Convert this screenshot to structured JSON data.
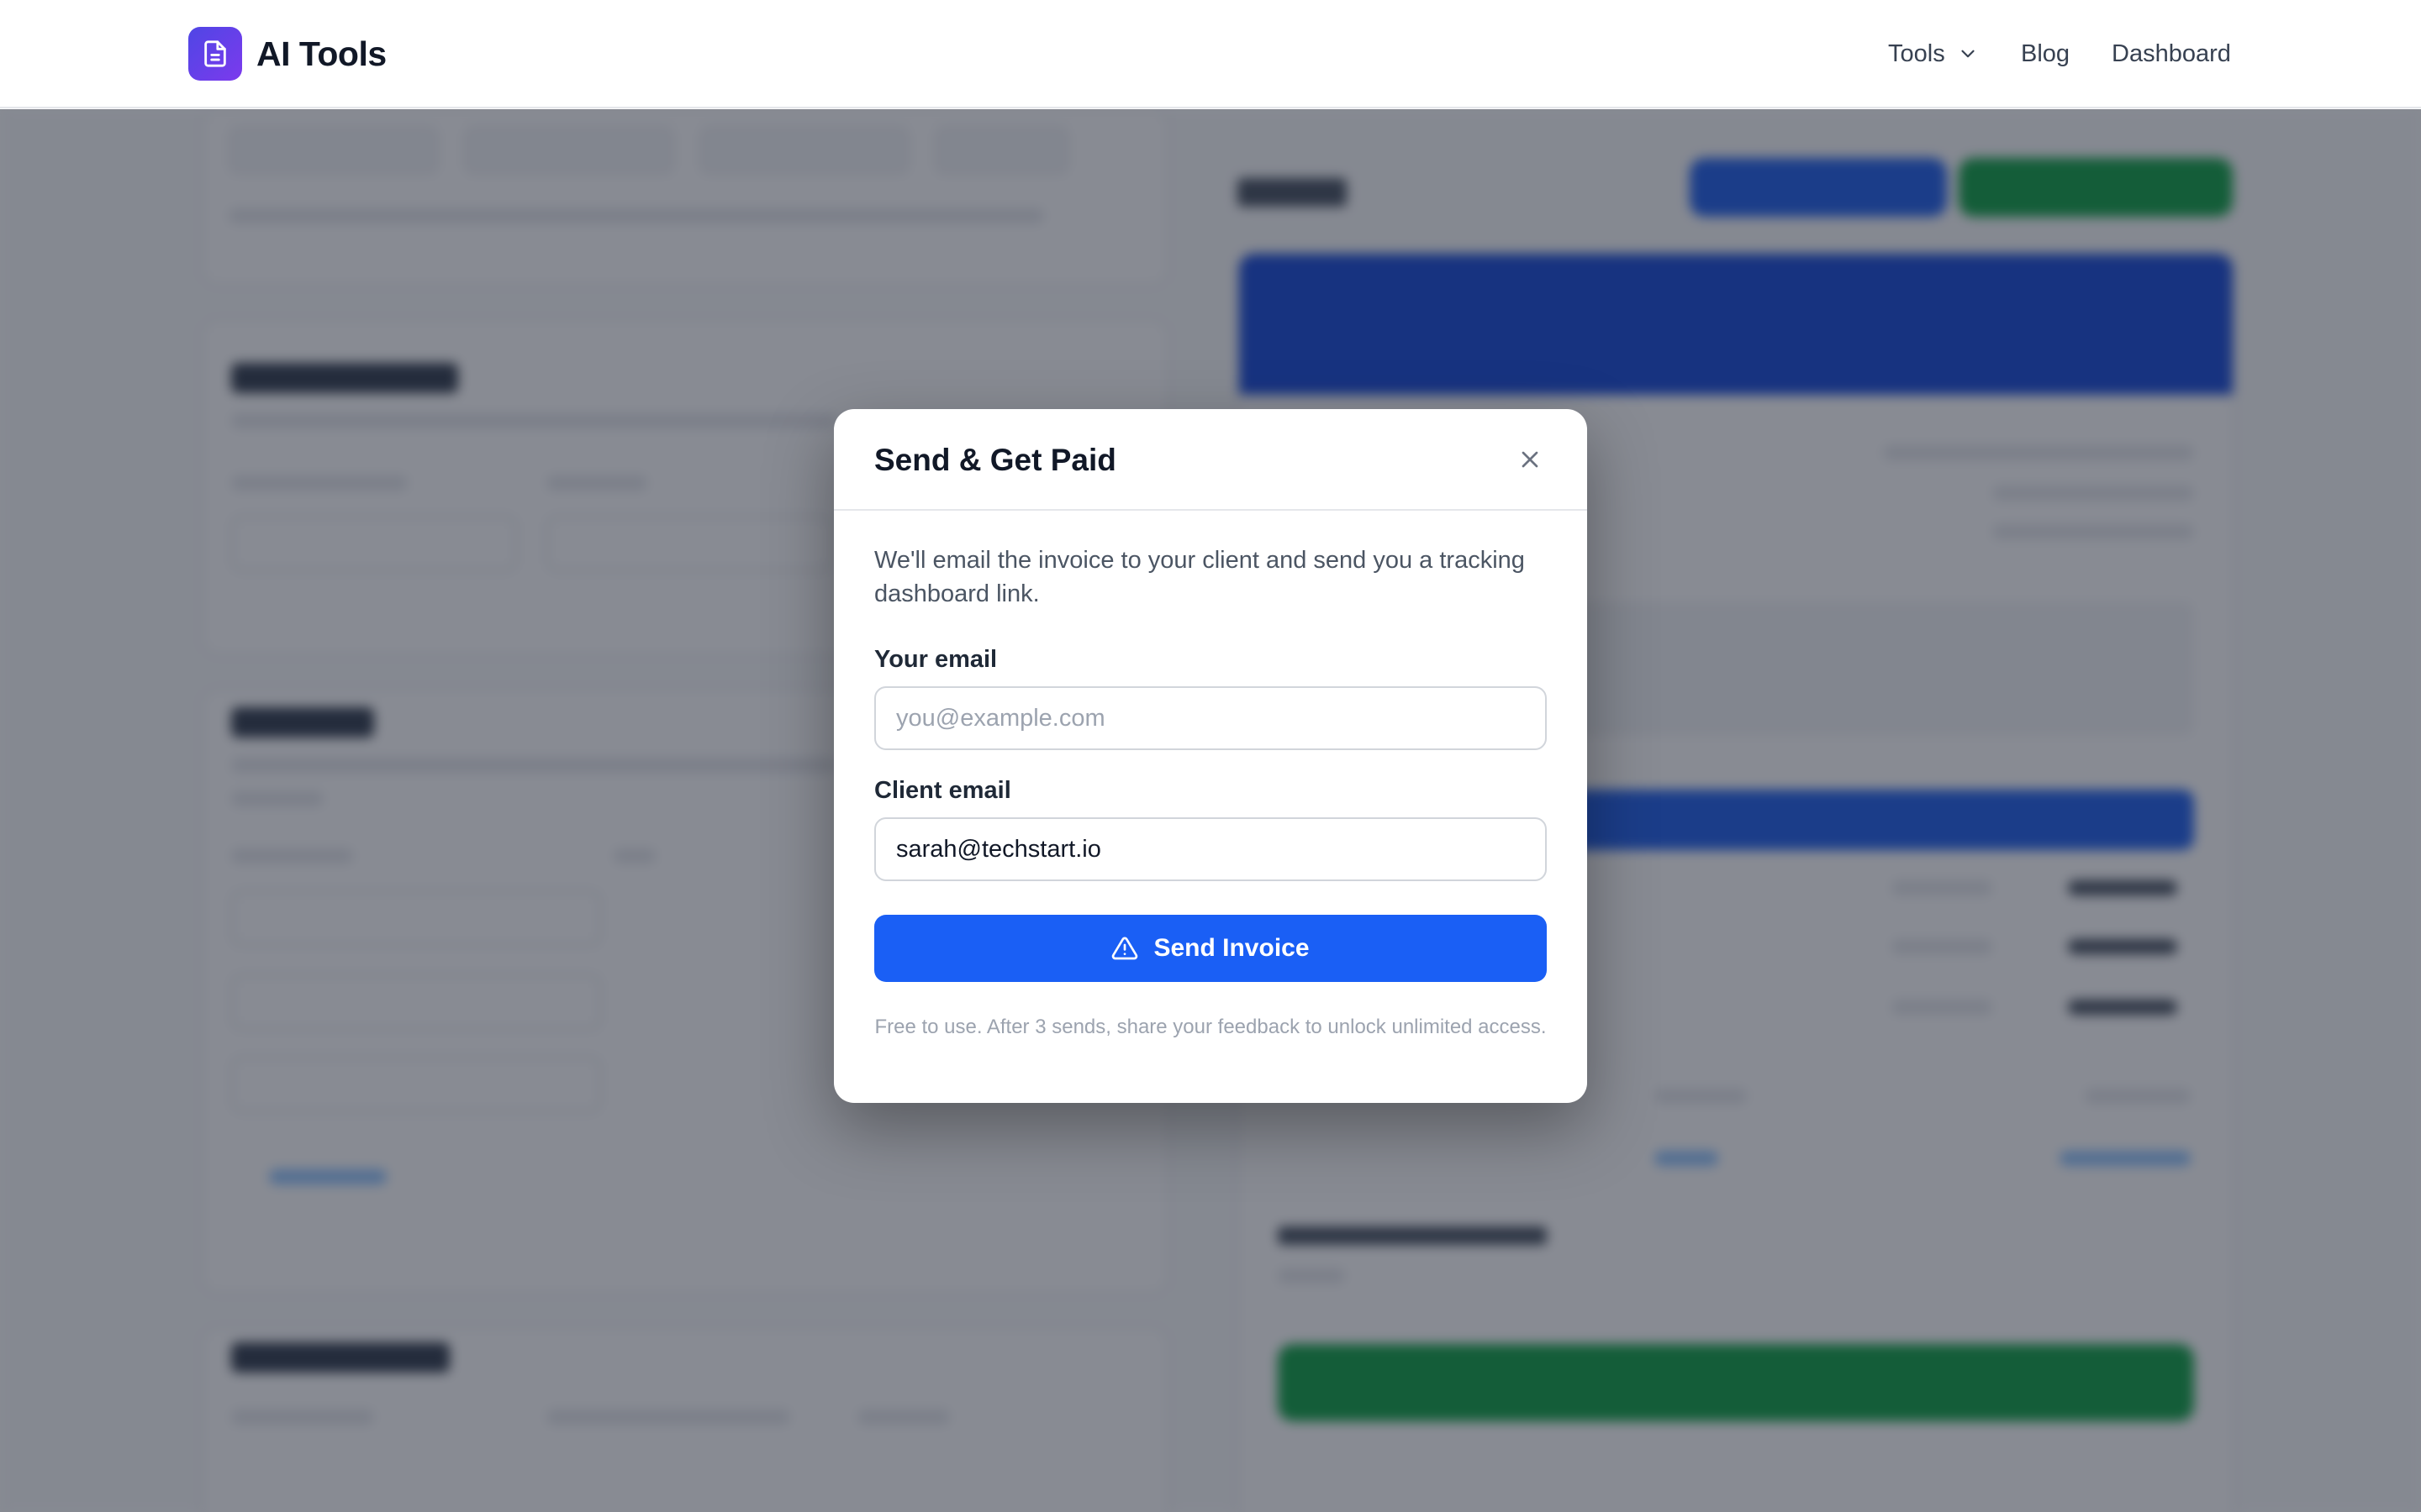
{
  "header": {
    "brand": "AI Tools",
    "nav": {
      "tools_label": "Tools",
      "blog_label": "Blog",
      "dashboard_label": "Dashboard"
    }
  },
  "modal": {
    "title": "Send & Get Paid",
    "description": "We'll email the invoice to your client and send you a tracking dashboard link.",
    "your_email": {
      "label": "Your email",
      "placeholder": "you@example.com",
      "value": ""
    },
    "client_email": {
      "label": "Client email",
      "placeholder": "",
      "value": "sarah@techstart.io"
    },
    "send_button_label": "Send Invoice",
    "footnote": "Free to use. After 3 sends, share your feedback to unlock unlimited access."
  },
  "colors": {
    "brand_gradient_start": "#4f46e5",
    "brand_gradient_end": "#7c3aed",
    "primary_button": "#1a5ff5",
    "overlay": "rgba(17,24,39,0.5)"
  },
  "icons": {
    "logo": "document-icon",
    "tools_chevron": "chevron-down-icon",
    "close": "close-icon",
    "send": "warning-triangle-icon"
  }
}
